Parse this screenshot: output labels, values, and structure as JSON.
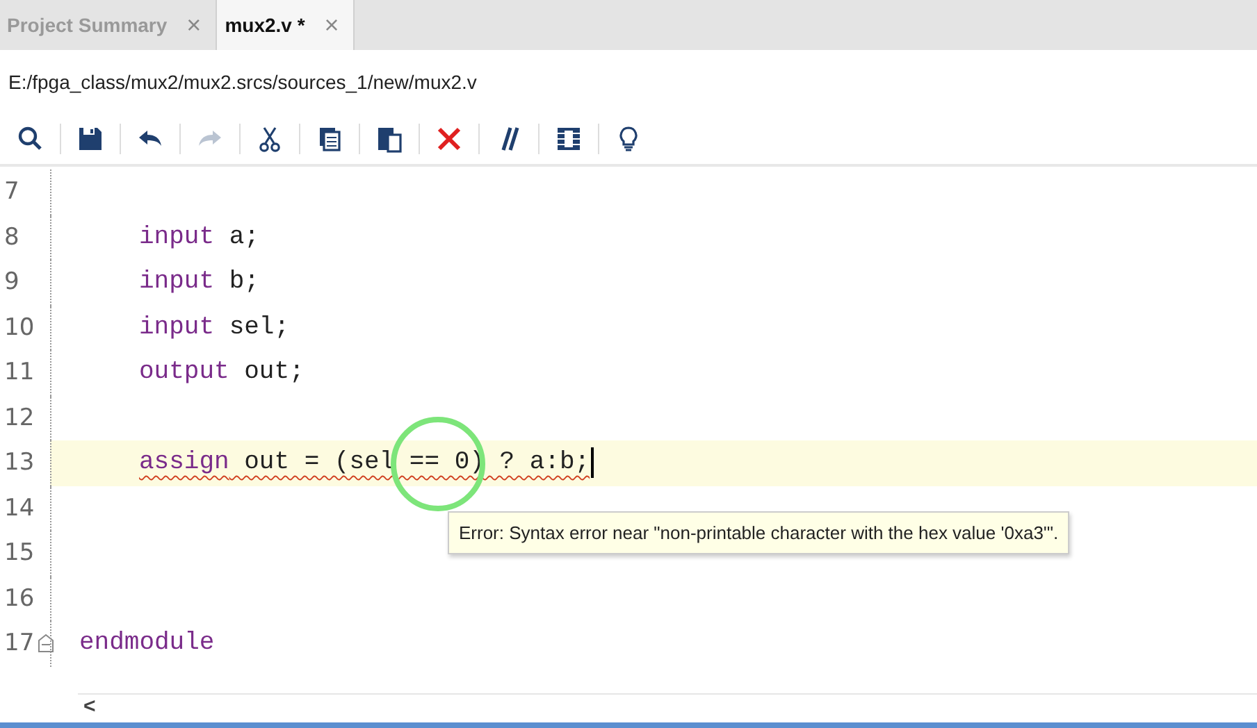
{
  "tabs": [
    {
      "label": "Project Summary",
      "close": "×",
      "selected": false
    },
    {
      "label": "mux2.v *",
      "close": "×",
      "selected": true
    }
  ],
  "file_path": "E:/fpga_class/mux2/mux2.srcs/sources_1/new/mux2.v",
  "toolbar": [
    {
      "kind": "search",
      "disabled": false
    },
    {
      "kind": "save",
      "disabled": false
    },
    {
      "kind": "undo",
      "disabled": false
    },
    {
      "kind": "redo",
      "disabled": true
    },
    {
      "kind": "cut",
      "disabled": false
    },
    {
      "kind": "copy",
      "disabled": false
    },
    {
      "kind": "paste",
      "disabled": false
    },
    {
      "kind": "delete",
      "disabled": false
    },
    {
      "kind": "comment",
      "disabled": false
    },
    {
      "kind": "columns",
      "disabled": false
    },
    {
      "kind": "bulb",
      "disabled": false
    }
  ],
  "editor": {
    "lines": [
      {
        "number": "7",
        "kind": "blank",
        "current": false,
        "error": false,
        "foldable": false
      },
      {
        "number": "8",
        "kind": "indented",
        "tokens": [
          {
            "text": "input",
            "kind": "keyword"
          },
          {
            "text": " a;",
            "kind": "plain"
          }
        ],
        "current": false,
        "error": false,
        "foldable": false
      },
      {
        "number": "9",
        "kind": "indented",
        "tokens": [
          {
            "text": "input",
            "kind": "keyword"
          },
          {
            "text": " b;",
            "kind": "plain"
          }
        ],
        "current": false,
        "error": false,
        "foldable": false
      },
      {
        "number": "10",
        "kind": "indented",
        "tokens": [
          {
            "text": "input",
            "kind": "keyword"
          },
          {
            "text": " sel;",
            "kind": "plain"
          }
        ],
        "current": false,
        "error": false,
        "foldable": false
      },
      {
        "number": "11",
        "kind": "indented",
        "tokens": [
          {
            "text": "output",
            "kind": "keyword"
          },
          {
            "text": " out;",
            "kind": "plain"
          }
        ],
        "current": false,
        "error": false,
        "foldable": false
      },
      {
        "number": "12",
        "kind": "blank",
        "current": false,
        "error": false,
        "foldable": false
      },
      {
        "number": "13",
        "kind": "indented",
        "tokens": [
          {
            "text": "assign",
            "kind": "keyword"
          },
          {
            "text": " out = (sel == 0) ? a:b;",
            "kind": "plain"
          }
        ],
        "current": true,
        "error": true,
        "foldable": false
      },
      {
        "number": "14",
        "kind": "blank",
        "current": false,
        "error": false,
        "foldable": false
      },
      {
        "number": "15",
        "kind": "blank",
        "current": false,
        "error": false,
        "foldable": false
      },
      {
        "number": "16",
        "kind": "blank",
        "current": false,
        "error": false,
        "foldable": false
      },
      {
        "number": "17",
        "kind": "top",
        "tokens": [
          {
            "text": "endmodule",
            "kind": "keyword"
          }
        ],
        "current": false,
        "error": false,
        "foldable": true
      }
    ],
    "tooltip": "Error: Syntax error near \"non-printable character with the hex value '0xa3'\".",
    "scroll_left": "<"
  }
}
